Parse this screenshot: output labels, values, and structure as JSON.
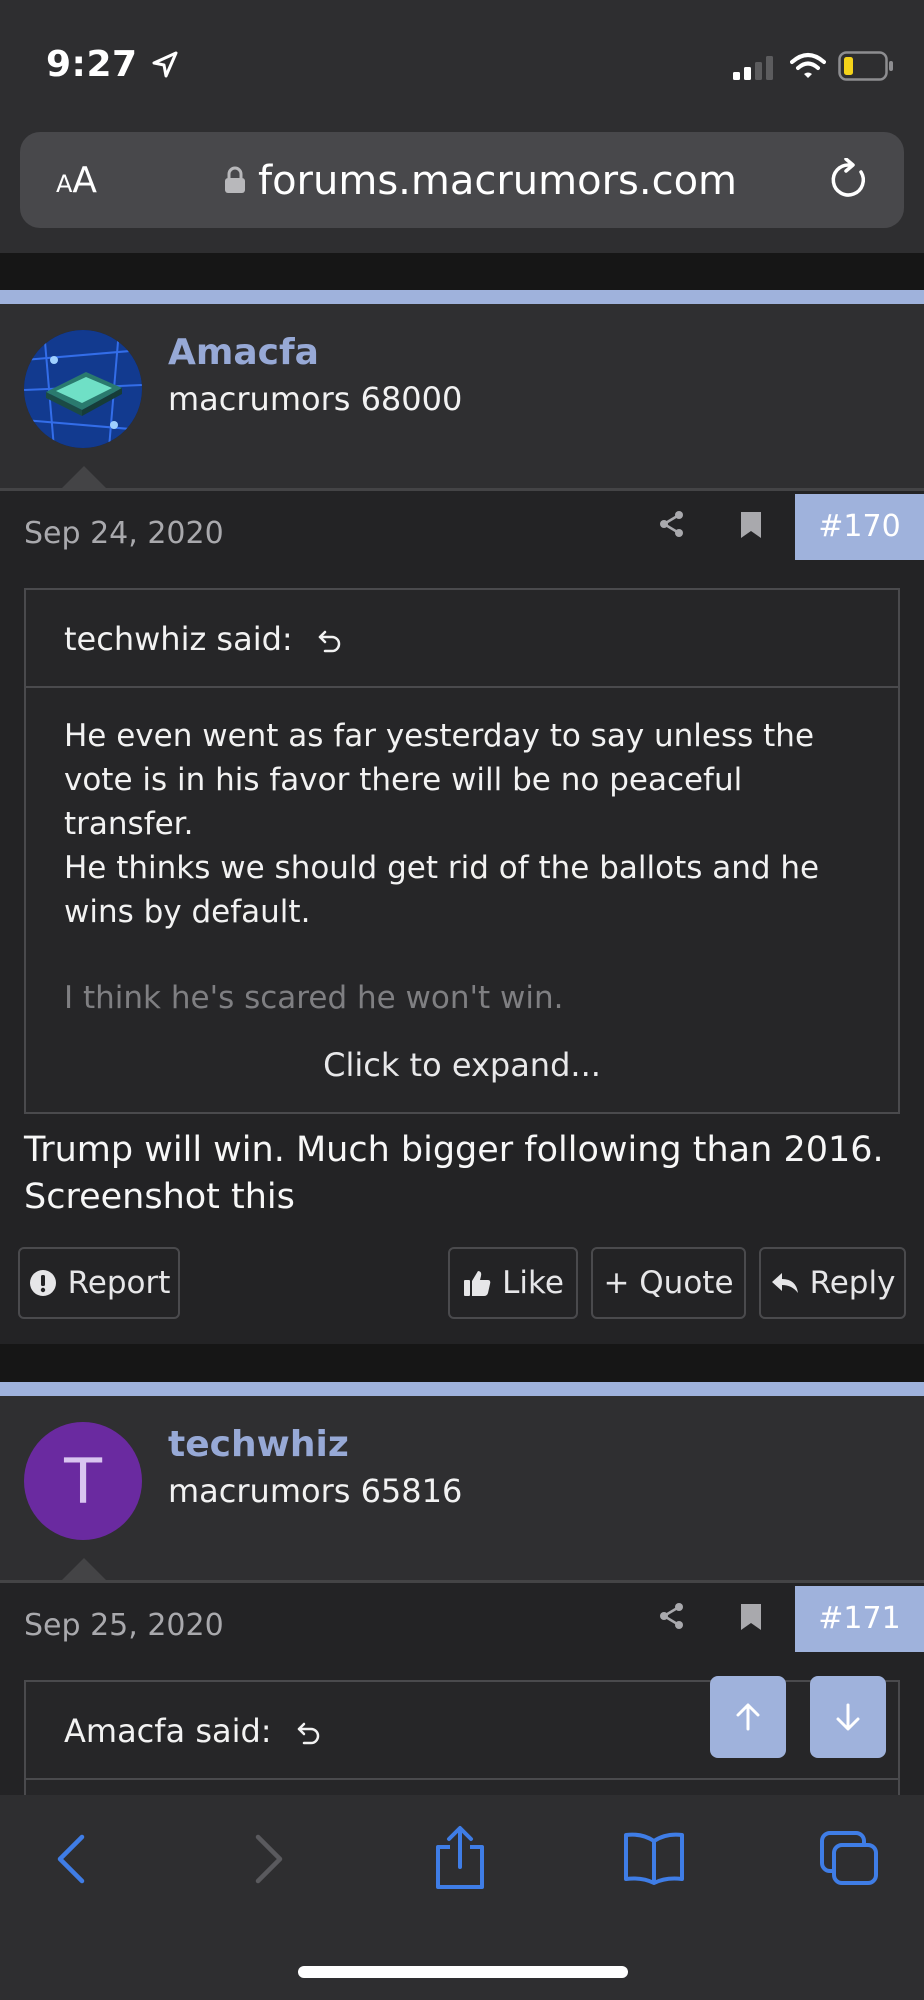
{
  "status_bar": {
    "time": "9:27"
  },
  "browser": {
    "text_size_label_small": "A",
    "text_size_label_large": "A",
    "url": "forums.macrumors.com"
  },
  "posts": [
    {
      "username": "Amacfa",
      "user_title": "macrumors 68000",
      "date": "Sep 24, 2020",
      "post_number": "#170",
      "quote": {
        "author": "techwhiz said:",
        "lines": [
          "He even went as far yesterday to say unless the",
          "vote is in his favor there will be no peaceful",
          "transfer.",
          "He thinks we should get rid of the ballots and he",
          "wins by default."
        ],
        "faded_line": "I think he's scared he won't win.",
        "expand_label": "Click to expand..."
      },
      "message_lines": [
        "Trump will win. Much bigger following than 2016.",
        "Screenshot this"
      ],
      "actions": {
        "report": "Report",
        "like": "Like",
        "quote": "+ Quote",
        "reply": "Reply"
      }
    },
    {
      "username": "techwhiz",
      "user_title": "macrumors 65816",
      "avatar_letter": "T",
      "avatar_color": "#6a2aa0",
      "date": "Sep 25, 2020",
      "post_number": "#171",
      "quote": {
        "author": "Amacfa said:"
      }
    }
  ],
  "colors": {
    "accent": "#9fb2dc",
    "username": "#97a9d6",
    "toolbar_icon": "#3f7de6"
  },
  "icons": [
    "location-arrow-icon",
    "signal-icon",
    "wifi-icon",
    "battery-icon",
    "lock-icon",
    "reload-icon",
    "share-icon",
    "bookmark-icon",
    "jump-arrow-icon",
    "alert-icon",
    "thumbs-up-icon",
    "reply-arrow-icon",
    "arrow-up-icon",
    "arrow-down-icon",
    "back-icon",
    "forward-icon",
    "share-sheet-icon",
    "book-icon",
    "tabs-icon"
  ]
}
